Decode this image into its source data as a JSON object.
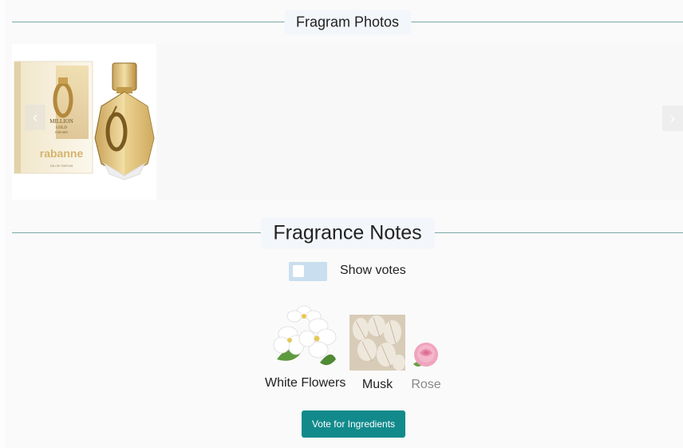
{
  "photos_section": {
    "title": "Fragram Photos"
  },
  "carousel": {
    "product": {
      "box_brand_text": "MILLION",
      "box_variant_text": "GOLD",
      "box_for_text": "FOR HER",
      "box_house_text": "rabanne",
      "box_type_text": "EAU DE PARFUM"
    },
    "prev_icon": "chevron-left-icon",
    "next_icon": "chevron-right-icon"
  },
  "notes_section": {
    "title": "Fragrance Notes"
  },
  "votes_toggle": {
    "label": "Show votes",
    "checked": false
  },
  "notes": [
    {
      "label": "White Flowers",
      "image": "white-flowers"
    },
    {
      "label": "Musk",
      "image": "musk"
    },
    {
      "label": "Rose",
      "image": "rose"
    }
  ],
  "vote_button": {
    "label": "Vote for Ingredients"
  },
  "colors": {
    "accent": "#128a8c",
    "divider": "#7aa8a8",
    "toggle_bg": "#c9dff0"
  }
}
